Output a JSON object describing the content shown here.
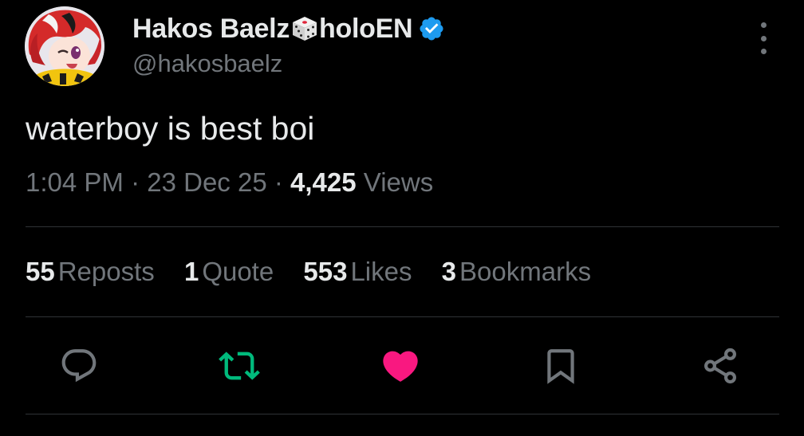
{
  "author": {
    "display_name": "Hakos Baelz",
    "affiliation": "holoEN",
    "handle": "@hakosbaelz",
    "verified": true,
    "name_emoji": "dice"
  },
  "tweet": {
    "text": "waterboy is best boi",
    "time": "1:04 PM",
    "date": "23 Dec 25",
    "views_count": "4,425",
    "views_label": "Views",
    "separator": "·"
  },
  "stats": [
    {
      "count": "55",
      "label": "Reposts"
    },
    {
      "count": "1",
      "label": "Quote"
    },
    {
      "count": "553",
      "label": "Likes"
    },
    {
      "count": "3",
      "label": "Bookmarks"
    }
  ],
  "actions": [
    {
      "name": "reply",
      "icon": "reply-icon",
      "color": "#71767b"
    },
    {
      "name": "repost",
      "icon": "repost-icon",
      "color": "#00ba7c",
      "active": true
    },
    {
      "name": "like",
      "icon": "heart-icon",
      "color": "#f91880",
      "active": true
    },
    {
      "name": "bookmark",
      "icon": "bookmark-icon",
      "color": "#71767b"
    },
    {
      "name": "share",
      "icon": "share-icon",
      "color": "#71767b"
    }
  ],
  "colors": {
    "background": "#000000",
    "text_primary": "#e7e9ea",
    "text_secondary": "#71767b",
    "verified_blue": "#1d9bf0",
    "repost_green": "#00ba7c",
    "like_pink": "#f91880",
    "divider": "#2f3336"
  }
}
